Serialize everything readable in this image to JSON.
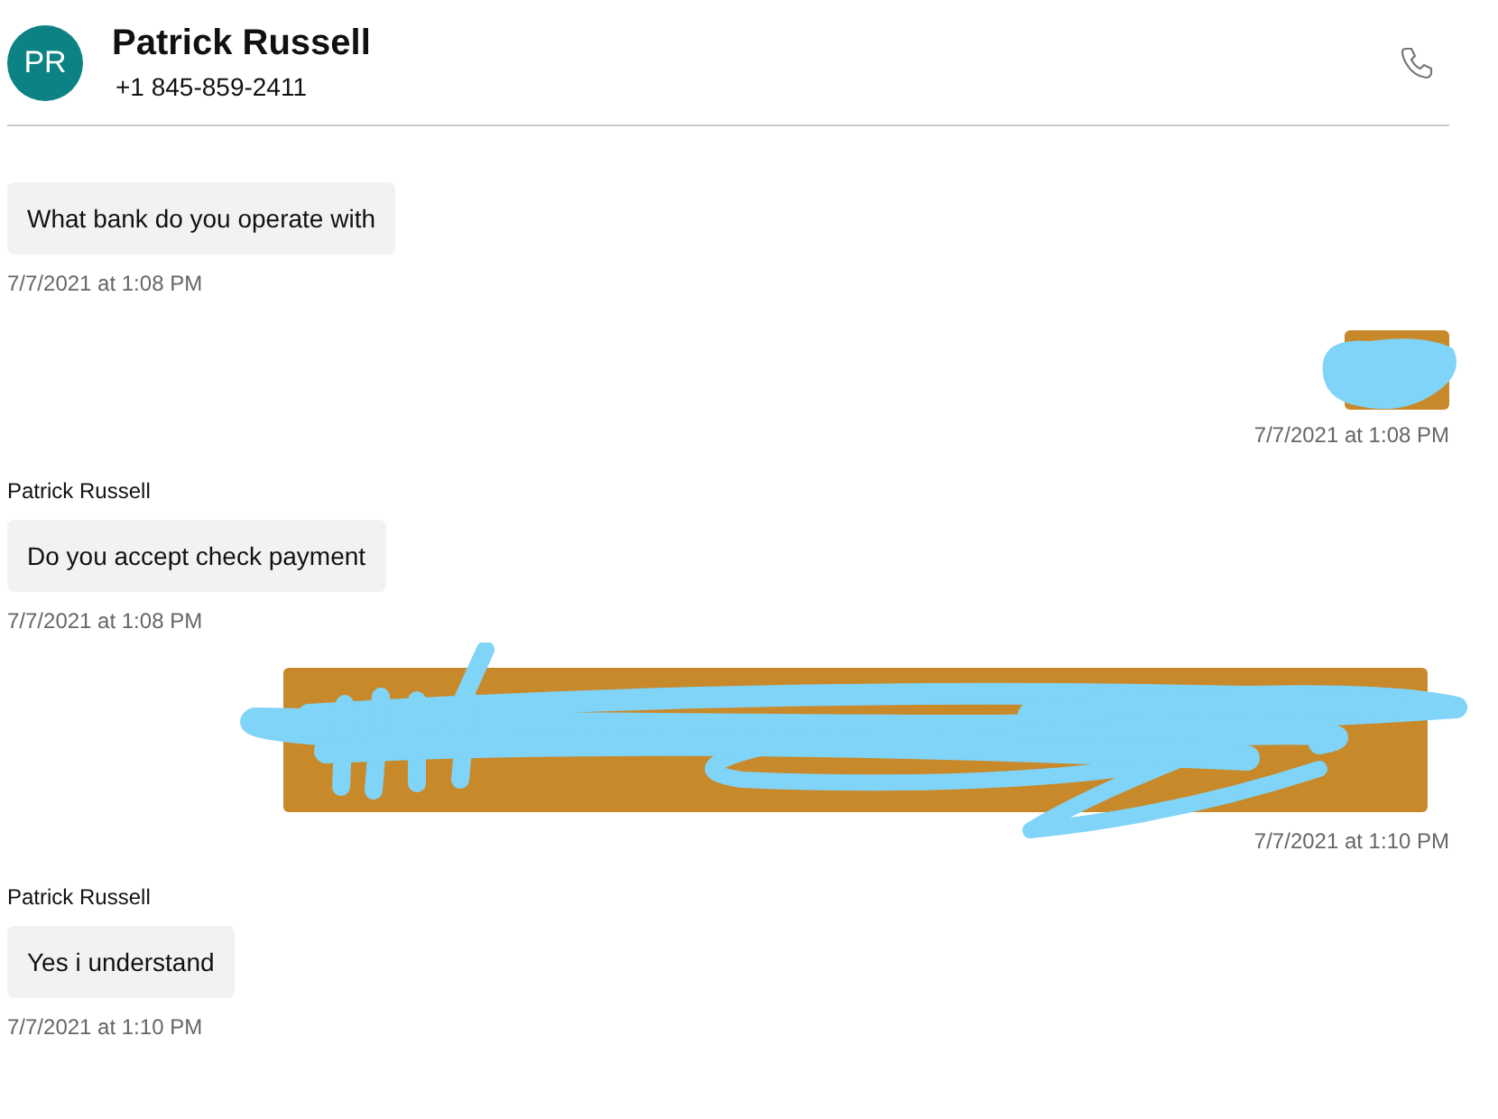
{
  "contact": {
    "initials": "PR",
    "name": "Patrick Russell",
    "phone": "+1 845-859-2411"
  },
  "messages": [
    {
      "kind": "incoming",
      "text": "What bank do you operate with",
      "time": "7/7/2021 at 1:08 PM"
    },
    {
      "kind": "outgoing",
      "time": "7/7/2021 at 1:08 PM"
    },
    {
      "kind": "incoming",
      "sender": "Patrick Russell",
      "text": "Do you accept check payment",
      "time": "7/7/2021 at 1:08 PM"
    },
    {
      "kind": "outgoing",
      "time": "7/7/2021 at 1:10 PM"
    },
    {
      "kind": "incoming",
      "sender": "Patrick Russell",
      "text": "Yes i understand",
      "time": "7/7/2021 at 1:10 PM"
    }
  ]
}
